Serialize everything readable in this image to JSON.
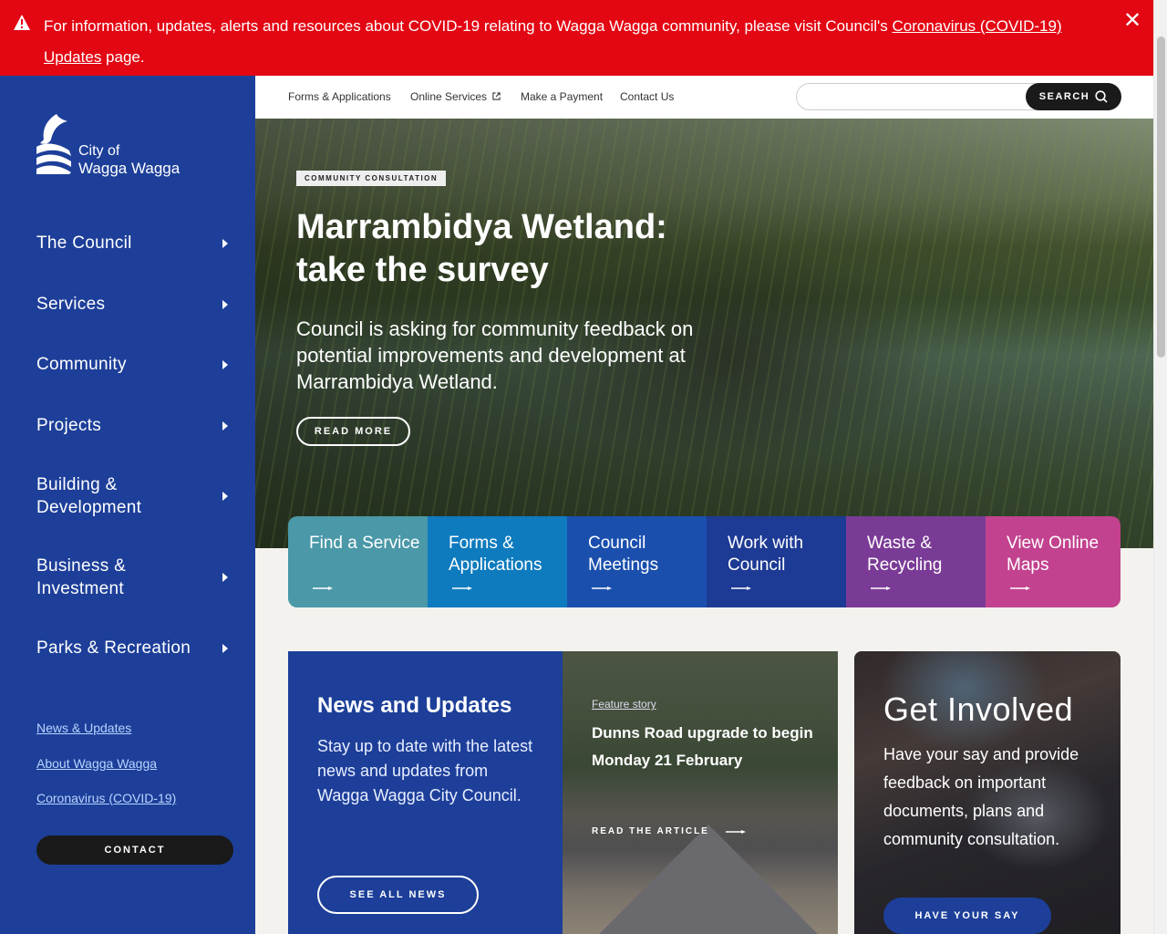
{
  "alert": {
    "text_before": "For information, updates, alerts and resources about COVID-19 relating to Wagga Wagga community, please visit Council's ",
    "link_text": "Coronavirus (COVID-19) Updates",
    "text_after": " page.",
    "icon": "warning-icon",
    "close_icon": "close-icon",
    "color": "#e30613"
  },
  "logo": {
    "line1": "City of",
    "line2": "Wagga Wagga"
  },
  "sidebar": {
    "color": "#1d3f99",
    "nav": [
      {
        "label": "The Council"
      },
      {
        "label": "Services"
      },
      {
        "label": "Community"
      },
      {
        "label": "Projects"
      },
      {
        "label": "Building & Development"
      },
      {
        "label": "Business & Investment"
      },
      {
        "label": "Parks & Recreation"
      }
    ],
    "links": [
      {
        "label": "News & Updates"
      },
      {
        "label": "About Wagga Wagga"
      },
      {
        "label": "Coronavirus (COVID-19)"
      }
    ],
    "contact_label": "CONTACT"
  },
  "topbar": {
    "links": [
      {
        "label": "Forms & Applications"
      },
      {
        "label": "Online Services",
        "external": true
      },
      {
        "label": "Make a Payment"
      },
      {
        "label": "Contact Us"
      }
    ],
    "search": {
      "placeholder": "",
      "value": "",
      "button_label": "SEARCH"
    }
  },
  "hero": {
    "badge": "COMMUNITY CONSULTATION",
    "title": "Marrambidya Wetland: take the survey",
    "description": "Council is asking for community feedback on potential improvements and development at Marrambidya Wetland.",
    "button_label": "READ MORE"
  },
  "tiles": [
    {
      "label": "Find a Service",
      "color": "#4a98a8"
    },
    {
      "label": "Forms & Applications",
      "color": "#0e7bbf"
    },
    {
      "label": "Council Meetings",
      "color": "#1a4fae"
    },
    {
      "label": "Work with Council",
      "color": "#1d3a94"
    },
    {
      "label": "Waste & Recycling",
      "color": "#7a3b96"
    },
    {
      "label": "View Online Maps",
      "color": "#c2428f"
    }
  ],
  "news": {
    "title": "News and Updates",
    "description": "Stay up to date with the latest news and updates from Wagga Wagga City Council.",
    "button_label": "SEE ALL NEWS"
  },
  "feature": {
    "tag": "Feature story",
    "title": "Dunns Road upgrade to begin Monday 21 February",
    "link_label": "READ THE ARTICLE"
  },
  "involved": {
    "title": "Get Involved",
    "description": "Have your say and provide feedback on important documents, plans and community consultation.",
    "button_label": "HAVE YOUR SAY"
  }
}
